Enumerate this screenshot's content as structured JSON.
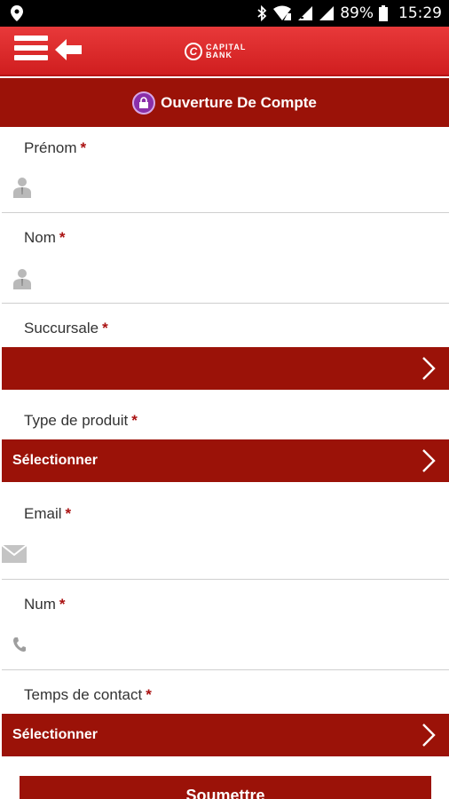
{
  "status_bar": {
    "battery": "89%",
    "time": "15:29"
  },
  "app_bar": {
    "logo_text_line1": "CAPITAL",
    "logo_text_line2": "BANK",
    "logo_mark": "C"
  },
  "section": {
    "title": "Ouverture De Compte"
  },
  "form": {
    "required_mark": "*",
    "prenom_label": "Prénom",
    "nom_label": "Nom",
    "succursale_label": "Succursale",
    "succursale_value": "",
    "type_produit_label": "Type de produit",
    "type_produit_value": "Sélectionner",
    "email_label": "Email",
    "num_label": "Num",
    "temps_contact_label": "Temps de contact",
    "temps_contact_value": "Sélectionner",
    "submit_label": "Soumettre"
  },
  "colors": {
    "accent": "#9b1208",
    "appbar": "#d62728",
    "status_bar": "#000000"
  },
  "icons": {
    "location": "location-pin-icon",
    "bluetooth": "bluetooth-icon",
    "wifi": "wifi-icon",
    "signal": "signal-icon",
    "battery": "battery-icon",
    "menu": "hamburger-menu-icon",
    "back": "back-arrow-icon",
    "lock": "lock-icon",
    "person": "person-icon",
    "email": "envelope-icon",
    "phone": "phone-icon",
    "chevron": "chevron-right-icon"
  }
}
